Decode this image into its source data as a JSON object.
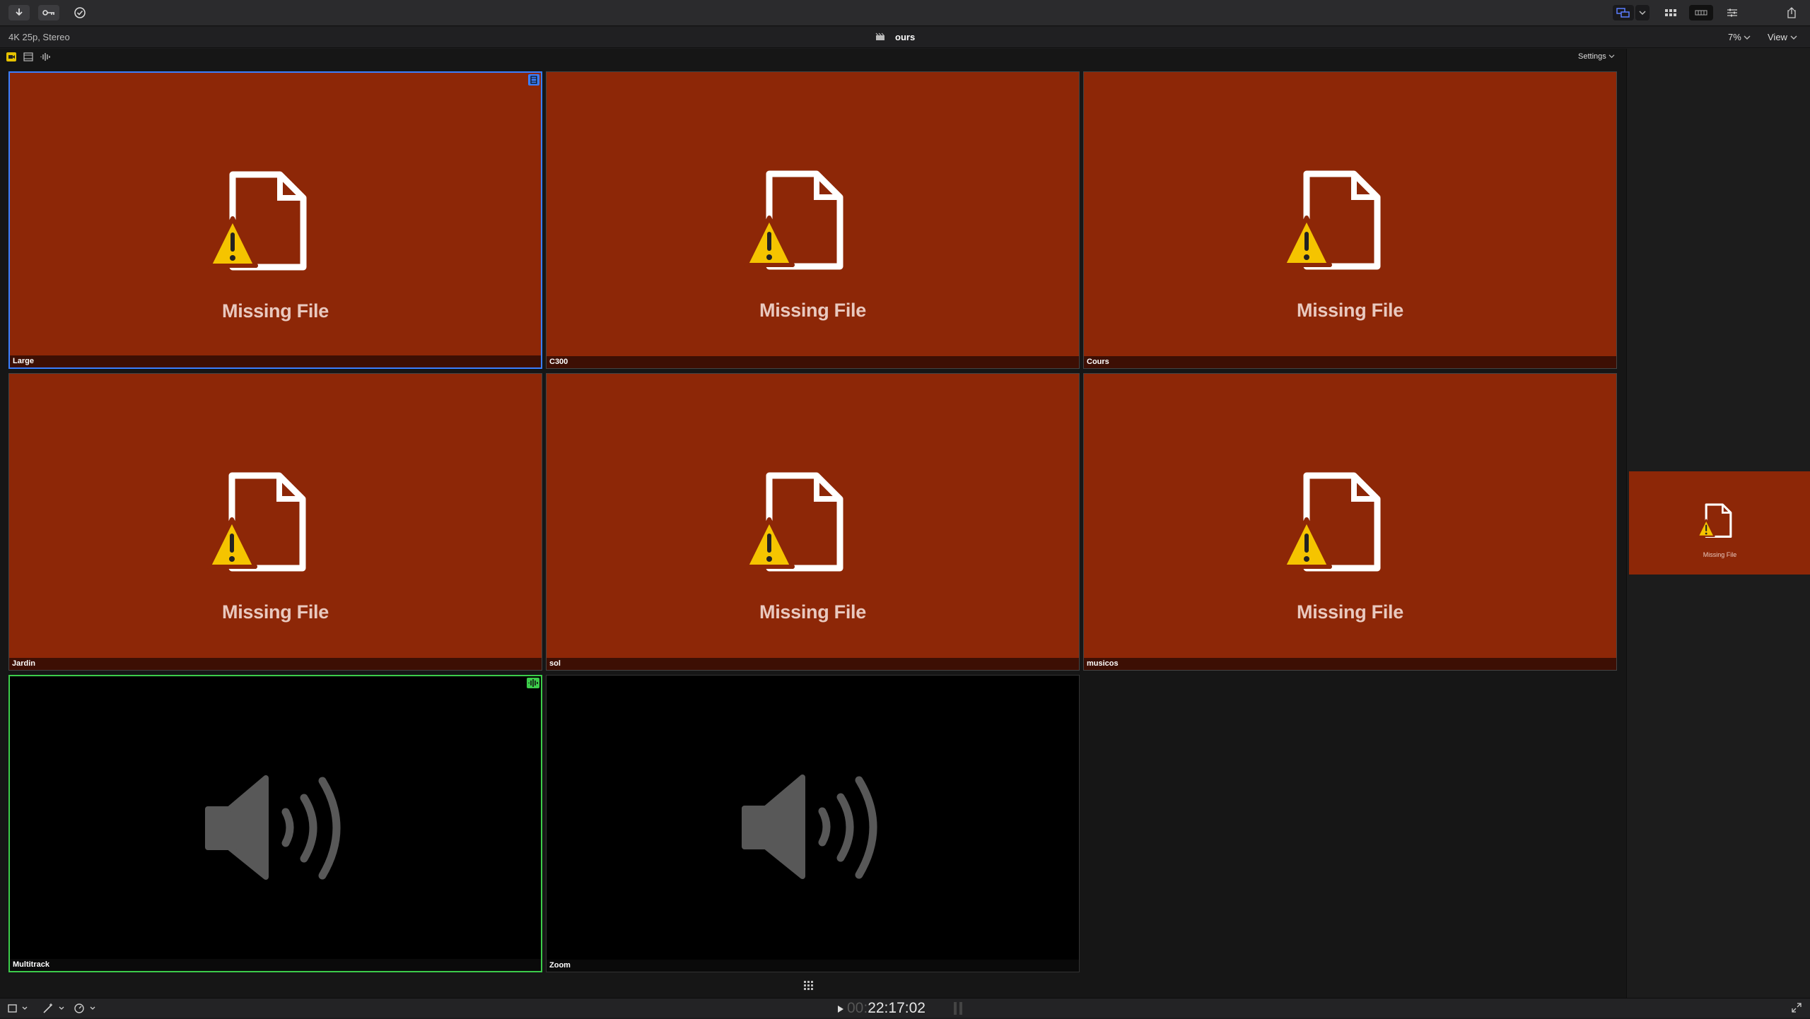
{
  "toolbar": {
    "left_buttons": [
      "import-icon",
      "keyword-icon",
      "checkmark-circle-icon"
    ],
    "right_buttons": [
      "multicam-view-icon",
      "chevron-down-icon",
      "browser-grid-icon",
      "timeline-icon",
      "inspector-icon",
      "share-icon"
    ]
  },
  "info": {
    "format": "4K 25p, Stereo",
    "clip_name": "ours",
    "zoom": "7%",
    "view_label": "View"
  },
  "angle_viewer": {
    "settings_label": "Settings",
    "angles": [
      {
        "label": "Large",
        "status": "Missing File",
        "type": "video",
        "active_video": true
      },
      {
        "label": "C300",
        "status": "Missing File",
        "type": "video"
      },
      {
        "label": "Cours",
        "status": "Missing File",
        "type": "video"
      },
      {
        "label": "Jardin",
        "status": "Missing File",
        "type": "video"
      },
      {
        "label": "sol",
        "status": "Missing File",
        "type": "video"
      },
      {
        "label": "musicos",
        "status": "Missing File",
        "type": "video"
      },
      {
        "label": "Multitrack",
        "status": "",
        "type": "audio",
        "active_audio": true
      },
      {
        "label": "Zoom",
        "status": "",
        "type": "audio"
      }
    ]
  },
  "main_viewer": {
    "status": "Missing File"
  },
  "playback": {
    "timecode_dim": "00:",
    "timecode": "22:17:02"
  },
  "colors": {
    "missing_bg": "#8d2707",
    "video_active": "#3a7fff",
    "audio_active": "#3ccc4a",
    "warning_yellow": "#f5c400"
  }
}
